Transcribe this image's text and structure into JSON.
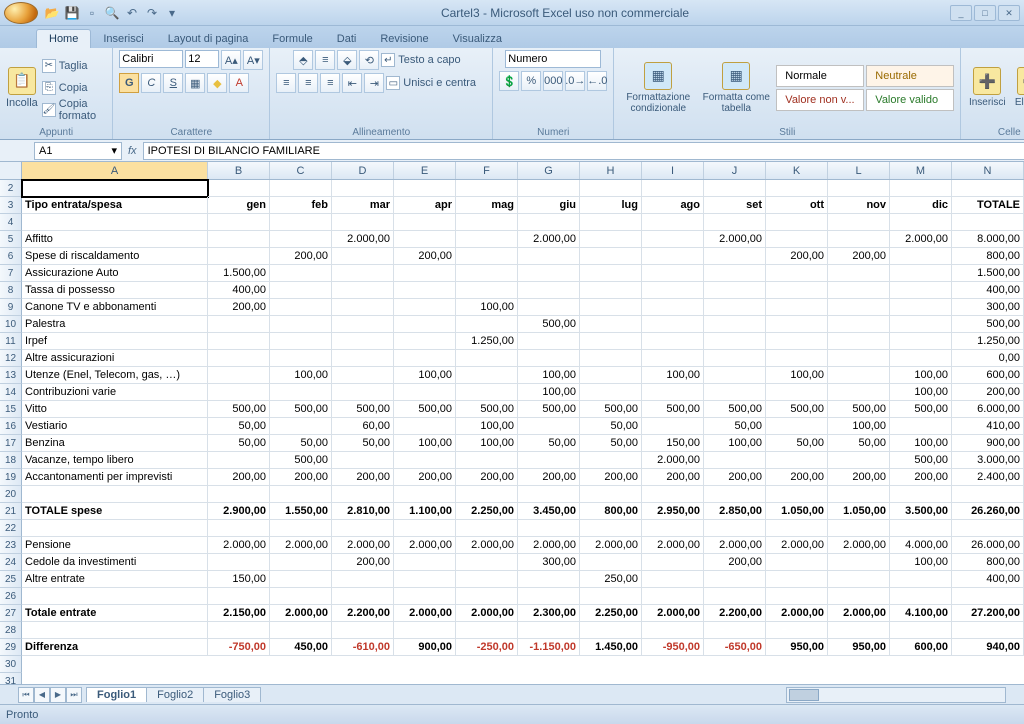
{
  "title": "Cartel3 - Microsoft Excel uso non commerciale",
  "tabs": [
    "Home",
    "Inserisci",
    "Layout di pagina",
    "Formule",
    "Dati",
    "Revisione",
    "Visualizza"
  ],
  "activeTab": 0,
  "ribbon": {
    "clipboard": {
      "label": "Appunti",
      "paste": "Incolla",
      "cut": "Taglia",
      "copy": "Copia",
      "format": "Copia formato"
    },
    "font": {
      "label": "Carattere",
      "name": "Calibri",
      "size": "12"
    },
    "align": {
      "label": "Allineamento",
      "wrap": "Testo a capo",
      "merge": "Unisci e centra"
    },
    "number": {
      "label": "Numeri",
      "format": "Numero"
    },
    "styles": {
      "label": "Stili",
      "condfmt": "Formattazione condizionale",
      "astable": "Formatta come tabella",
      "normal": "Normale",
      "neutral": "Neutrale",
      "bad": "Valore non v...",
      "good": "Valore valido"
    },
    "cells": {
      "label": "Celle",
      "insert": "Inserisci",
      "delete": "Elimina"
    }
  },
  "namebox": "A1",
  "formula": "IPOTESI DI BILANCIO FAMILIARE",
  "columns": [
    "A",
    "B",
    "C",
    "D",
    "E",
    "F",
    "G",
    "H",
    "I",
    "J",
    "K",
    "L",
    "M",
    "N"
  ],
  "colClasses": [
    "cA",
    "cB",
    "cC",
    "cD",
    "cE",
    "cF",
    "cG",
    "cH",
    "cI",
    "cJ",
    "cK",
    "cL",
    "cM",
    "cN"
  ],
  "rows": [
    {
      "n": 2,
      "c": [
        "",
        "",
        "",
        "",
        "",
        "",
        "",
        "",
        "",
        "",
        "",
        "",
        "",
        ""
      ]
    },
    {
      "n": 3,
      "b": true,
      "c": [
        "Tipo entrata/spesa",
        "gen",
        "feb",
        "mar",
        "apr",
        "mag",
        "giu",
        "lug",
        "ago",
        "set",
        "ott",
        "nov",
        "dic",
        "TOTALE"
      ]
    },
    {
      "n": 4,
      "c": [
        "",
        "",
        "",
        "",
        "",
        "",
        "",
        "",
        "",
        "",
        "",
        "",
        "",
        ""
      ]
    },
    {
      "n": 5,
      "c": [
        "Affitto",
        "",
        "",
        "2.000,00",
        "",
        "",
        "2.000,00",
        "",
        "",
        "2.000,00",
        "",
        "",
        "2.000,00",
        "8.000,00"
      ]
    },
    {
      "n": 6,
      "c": [
        "Spese di riscaldamento",
        "",
        "200,00",
        "",
        "200,00",
        "",
        "",
        "",
        "",
        "",
        "200,00",
        "200,00",
        "",
        "800,00"
      ]
    },
    {
      "n": 7,
      "c": [
        "Assicurazione Auto",
        "1.500,00",
        "",
        "",
        "",
        "",
        "",
        "",
        "",
        "",
        "",
        "",
        "",
        "1.500,00"
      ]
    },
    {
      "n": 8,
      "c": [
        "Tassa di possesso",
        "400,00",
        "",
        "",
        "",
        "",
        "",
        "",
        "",
        "",
        "",
        "",
        "",
        "400,00"
      ]
    },
    {
      "n": 9,
      "c": [
        "Canone TV e abbonamenti",
        "200,00",
        "",
        "",
        "",
        "100,00",
        "",
        "",
        "",
        "",
        "",
        "",
        "",
        "300,00"
      ]
    },
    {
      "n": 10,
      "c": [
        "Palestra",
        "",
        "",
        "",
        "",
        "",
        "500,00",
        "",
        "",
        "",
        "",
        "",
        "",
        "500,00"
      ]
    },
    {
      "n": 11,
      "c": [
        "Irpef",
        "",
        "",
        "",
        "",
        "1.250,00",
        "",
        "",
        "",
        "",
        "",
        "",
        "",
        "1.250,00"
      ]
    },
    {
      "n": 12,
      "c": [
        "Altre assicurazioni",
        "",
        "",
        "",
        "",
        "",
        "",
        "",
        "",
        "",
        "",
        "",
        "",
        "0,00"
      ]
    },
    {
      "n": 13,
      "c": [
        "Utenze (Enel, Telecom, gas, …)",
        "",
        "100,00",
        "",
        "100,00",
        "",
        "100,00",
        "",
        "100,00",
        "",
        "100,00",
        "",
        "100,00",
        "600,00"
      ]
    },
    {
      "n": 14,
      "c": [
        "Contribuzioni varie",
        "",
        "",
        "",
        "",
        "",
        "100,00",
        "",
        "",
        "",
        "",
        "",
        "100,00",
        "200,00"
      ]
    },
    {
      "n": 15,
      "c": [
        "Vitto",
        "500,00",
        "500,00",
        "500,00",
        "500,00",
        "500,00",
        "500,00",
        "500,00",
        "500,00",
        "500,00",
        "500,00",
        "500,00",
        "500,00",
        "6.000,00"
      ]
    },
    {
      "n": 16,
      "c": [
        "Vestiario",
        "50,00",
        "",
        "60,00",
        "",
        "100,00",
        "",
        "50,00",
        "",
        "50,00",
        "",
        "100,00",
        "",
        "410,00"
      ]
    },
    {
      "n": 17,
      "c": [
        "Benzina",
        "50,00",
        "50,00",
        "50,00",
        "100,00",
        "100,00",
        "50,00",
        "50,00",
        "150,00",
        "100,00",
        "50,00",
        "50,00",
        "100,00",
        "900,00"
      ]
    },
    {
      "n": 18,
      "c": [
        "Vacanze, tempo libero",
        "",
        "500,00",
        "",
        "",
        "",
        "",
        "",
        "2.000,00",
        "",
        "",
        "",
        "500,00",
        "3.000,00"
      ]
    },
    {
      "n": 19,
      "c": [
        "Accantonamenti per imprevisti",
        "200,00",
        "200,00",
        "200,00",
        "200,00",
        "200,00",
        "200,00",
        "200,00",
        "200,00",
        "200,00",
        "200,00",
        "200,00",
        "200,00",
        "2.400,00"
      ]
    },
    {
      "n": 20,
      "c": [
        "",
        "",
        "",
        "",
        "",
        "",
        "",
        "",
        "",
        "",
        "",
        "",
        "",
        ""
      ]
    },
    {
      "n": 21,
      "b": true,
      "c": [
        "TOTALE spese",
        "2.900,00",
        "1.550,00",
        "2.810,00",
        "1.100,00",
        "2.250,00",
        "3.450,00",
        "800,00",
        "2.950,00",
        "2.850,00",
        "1.050,00",
        "1.050,00",
        "3.500,00",
        "26.260,00"
      ]
    },
    {
      "n": 22,
      "c": [
        "",
        "",
        "",
        "",
        "",
        "",
        "",
        "",
        "",
        "",
        "",
        "",
        "",
        ""
      ]
    },
    {
      "n": 23,
      "c": [
        "Pensione",
        "2.000,00",
        "2.000,00",
        "2.000,00",
        "2.000,00",
        "2.000,00",
        "2.000,00",
        "2.000,00",
        "2.000,00",
        "2.000,00",
        "2.000,00",
        "2.000,00",
        "4.000,00",
        "26.000,00"
      ]
    },
    {
      "n": 24,
      "c": [
        "Cedole da investimenti",
        "",
        "",
        "200,00",
        "",
        "",
        "300,00",
        "",
        "",
        "200,00",
        "",
        "",
        "100,00",
        "800,00"
      ]
    },
    {
      "n": 25,
      "c": [
        "Altre entrate",
        "150,00",
        "",
        "",
        "",
        "",
        "",
        "250,00",
        "",
        "",
        "",
        "",
        "",
        "400,00"
      ]
    },
    {
      "n": 26,
      "c": [
        "",
        "",
        "",
        "",
        "",
        "",
        "",
        "",
        "",
        "",
        "",
        "",
        "",
        ""
      ]
    },
    {
      "n": 27,
      "b": true,
      "c": [
        "Totale entrate",
        "2.150,00",
        "2.000,00",
        "2.200,00",
        "2.000,00",
        "2.000,00",
        "2.300,00",
        "2.250,00",
        "2.000,00",
        "2.200,00",
        "2.000,00",
        "2.000,00",
        "4.100,00",
        "27.200,00"
      ]
    },
    {
      "n": 28,
      "c": [
        "",
        "",
        "",
        "",
        "",
        "",
        "",
        "",
        "",
        "",
        "",
        "",
        "",
        ""
      ]
    },
    {
      "n": 29,
      "b": true,
      "neg": [
        1,
        3,
        5,
        6,
        8,
        9
      ],
      "c": [
        "Differenza",
        "-750,00",
        "450,00",
        "-610,00",
        "900,00",
        "-250,00",
        "-1.150,00",
        "1.450,00",
        "-950,00",
        "-650,00",
        "950,00",
        "950,00",
        "600,00",
        "940,00"
      ]
    }
  ],
  "sheets": [
    "Foglio1",
    "Foglio2",
    "Foglio3"
  ],
  "activeSheet": 0,
  "status": "Pronto"
}
